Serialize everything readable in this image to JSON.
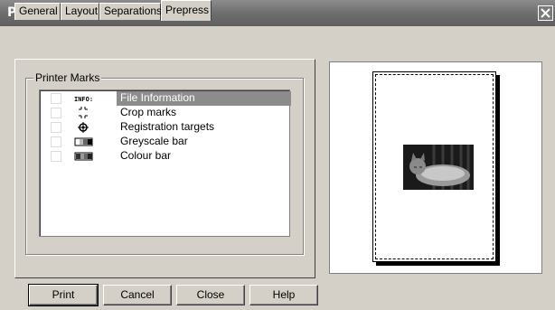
{
  "window": {
    "title": "Print"
  },
  "tabs": [
    {
      "label": "General"
    },
    {
      "label": "Layout"
    },
    {
      "label": "Separations"
    },
    {
      "label": "Prepress",
      "active": true
    }
  ],
  "printer_marks": {
    "legend": "Printer Marks",
    "items": [
      {
        "label": "File Information",
        "icon": "info-text-icon",
        "icon_text": "INFO:",
        "selected": true,
        "checked": false
      },
      {
        "label": "Crop marks",
        "icon": "crop-marks-icon",
        "checked": false
      },
      {
        "label": "Registration targets",
        "icon": "registration-target-icon",
        "checked": false
      },
      {
        "label": "Greyscale bar",
        "icon": "greyscale-bar-icon",
        "checked": false
      },
      {
        "label": "Colour bar",
        "icon": "colour-bar-icon",
        "checked": false
      }
    ]
  },
  "buttons": {
    "print": "Print",
    "cancel": "Cancel",
    "close": "Close",
    "help": "Help"
  },
  "colors": {
    "titlebar": "#6e6e6e",
    "face": "#d4d0c8",
    "selection": "#8c8c8c"
  }
}
